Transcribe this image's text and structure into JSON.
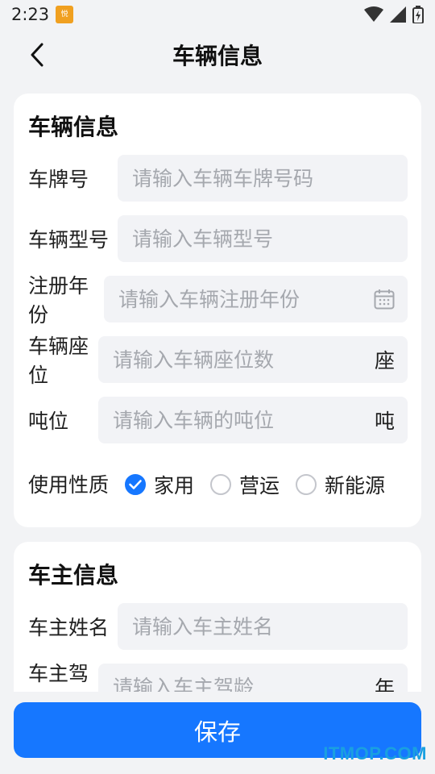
{
  "status_bar": {
    "time": "2:23",
    "app_badge": "悦",
    "icons": [
      "wifi-icon",
      "signal-icon",
      "battery-icon"
    ]
  },
  "nav": {
    "title": "车辆信息",
    "back_icon": "chevron-left-icon"
  },
  "vehicle_section": {
    "title": "车辆信息",
    "fields": [
      {
        "label": "车牌号",
        "placeholder": "请输入车辆车牌号码",
        "value": ""
      },
      {
        "label": "车辆型号",
        "placeholder": "请输入车辆型号",
        "value": ""
      },
      {
        "label": "注册年份",
        "placeholder": "请输入车辆注册年份",
        "value": "",
        "icon": "calendar-icon"
      },
      {
        "label": "车辆座位",
        "placeholder": "请输入车辆座位数",
        "value": "",
        "unit": "座"
      },
      {
        "label": "吨位",
        "placeholder": "请输入车辆的吨位",
        "value": "",
        "unit": "吨"
      }
    ],
    "usage": {
      "label": "使用性质",
      "options": [
        {
          "label": "家用",
          "checked": true
        },
        {
          "label": "营运",
          "checked": false
        },
        {
          "label": "新能源",
          "checked": false
        }
      ]
    }
  },
  "owner_section": {
    "title": "车主信息",
    "fields": [
      {
        "label": "车主姓名",
        "placeholder": "请输入车主姓名",
        "value": ""
      },
      {
        "label": "车主驾龄",
        "placeholder": "请输入车主驾龄",
        "value": "",
        "unit": "年"
      }
    ]
  },
  "save_button": {
    "label": "保存"
  },
  "watermark": "ITMOP.COM",
  "colors": {
    "accent": "#1677ff",
    "background": "#f2f3f5",
    "field_bg": "#f2f3f6"
  }
}
